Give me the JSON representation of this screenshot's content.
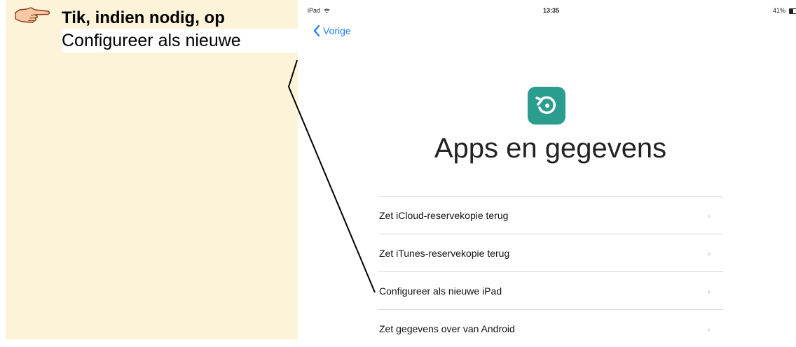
{
  "instruction": {
    "hand_icon": "pointing-hand-icon",
    "line1": "Tik, indien nodig, op",
    "line2": "Configureer als nieuwe"
  },
  "statusbar": {
    "device": "iPad",
    "wifi_icon": "wifi-icon",
    "time": "13:35",
    "battery_text": "41%",
    "battery_level": 0.41
  },
  "nav": {
    "back_label": "Vorige",
    "back_icon": "chevron-left-icon",
    "accent": "#1a7ff5"
  },
  "screen": {
    "icon": "restore-icon",
    "icon_color": "#2a9d8f",
    "title": "Apps en gegevens"
  },
  "options": [
    {
      "label": "Zet iCloud-reservekopie terug"
    },
    {
      "label": "Zet iTunes-reservekopie terug"
    },
    {
      "label": "Configureer als nieuwe iPad"
    },
    {
      "label": "Zet gegevens over van Android"
    }
  ]
}
